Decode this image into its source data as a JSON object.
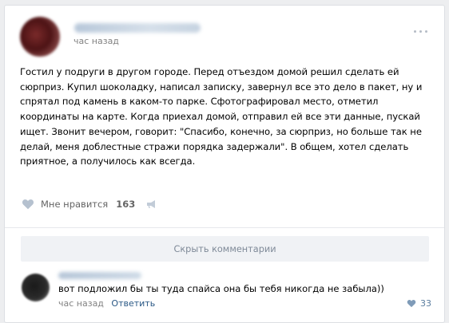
{
  "post": {
    "time": "час назад",
    "text": "Гостил у подруги в другом городе. Перед отъездом домой решил сделать ей\nсюрприз. Купил шоколадку, написал записку, завернул все это дело в пакет, ну и\nспрятал под камень в каком-то парке. Сфотографировал место, отметил\nкоординаты на карте. Когда приехал домой, отправил ей все эти данные, пускай\nищет. Звонит вечером, говорит: \"Спасибо, конечно, за сюрприз, но больше так не\nделай, меня доблестные стражи порядка задержали\". В общем, хотел сделать\nприятное, а получилось как всегда."
  },
  "actions": {
    "like_label": "Мне нравится",
    "like_count": "163",
    "hide_comments": "Скрыть комментарии"
  },
  "comment": {
    "text": "вот подложил бы ты туда спайса она бы тебя никогда не забыла))",
    "time": "час назад",
    "reply": "Ответить",
    "likes": "33"
  },
  "colors": {
    "link": "#2a5885",
    "muted": "#828282",
    "background": "#edeef0"
  },
  "icons": [
    "more-icon",
    "heart-icon",
    "share-icon"
  ]
}
